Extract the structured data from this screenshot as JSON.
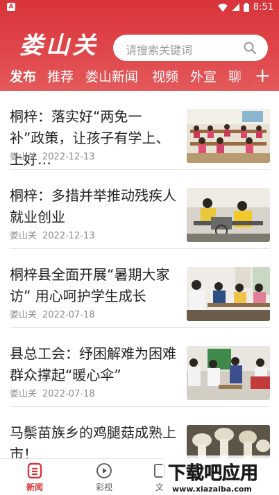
{
  "status": {
    "time": "8:51"
  },
  "header": {
    "logo_text": "娄山关",
    "search_placeholder": "请搜索关键词",
    "tabs": [
      "发布",
      "推荐",
      "娄山新闻",
      "视频",
      "外宣",
      "聊"
    ],
    "active_tab": "发布"
  },
  "feed": {
    "items": [
      {
        "title": "桐梓：落实好“两免一补”政策，让孩子有学上、上好…",
        "source": "娄山关",
        "date": "2022-12-13"
      },
      {
        "title": "桐梓：多措并举推动残疾人就业创业",
        "source": "娄山关",
        "date": "2022-12-13"
      },
      {
        "title": "桐梓县全面开展“暑期大家访” 用心呵护学生成长",
        "source": "娄山关",
        "date": "2022-07-18"
      },
      {
        "title": "县总工会：纾困解难为困难群众撑起“暖心伞”",
        "source": "娄山关",
        "date": "2022-07-18"
      },
      {
        "title": "马鬃苗族乡的鸡腿菇成熟上市！",
        "source": "",
        "date": ""
      }
    ]
  },
  "tabbar": {
    "items": [
      {
        "label": "新闻",
        "icon": "news-icon",
        "active": true
      },
      {
        "label": "彩视",
        "icon": "play-icon",
        "active": false
      },
      {
        "label": "文",
        "icon": "doc-icon",
        "active": false
      }
    ]
  },
  "watermark": {
    "text": "下载吧应用",
    "url_text": "www.xiazaiba.com"
  },
  "colors": {
    "brand_red": "#d8343a",
    "active_tab": "#d8343a"
  }
}
